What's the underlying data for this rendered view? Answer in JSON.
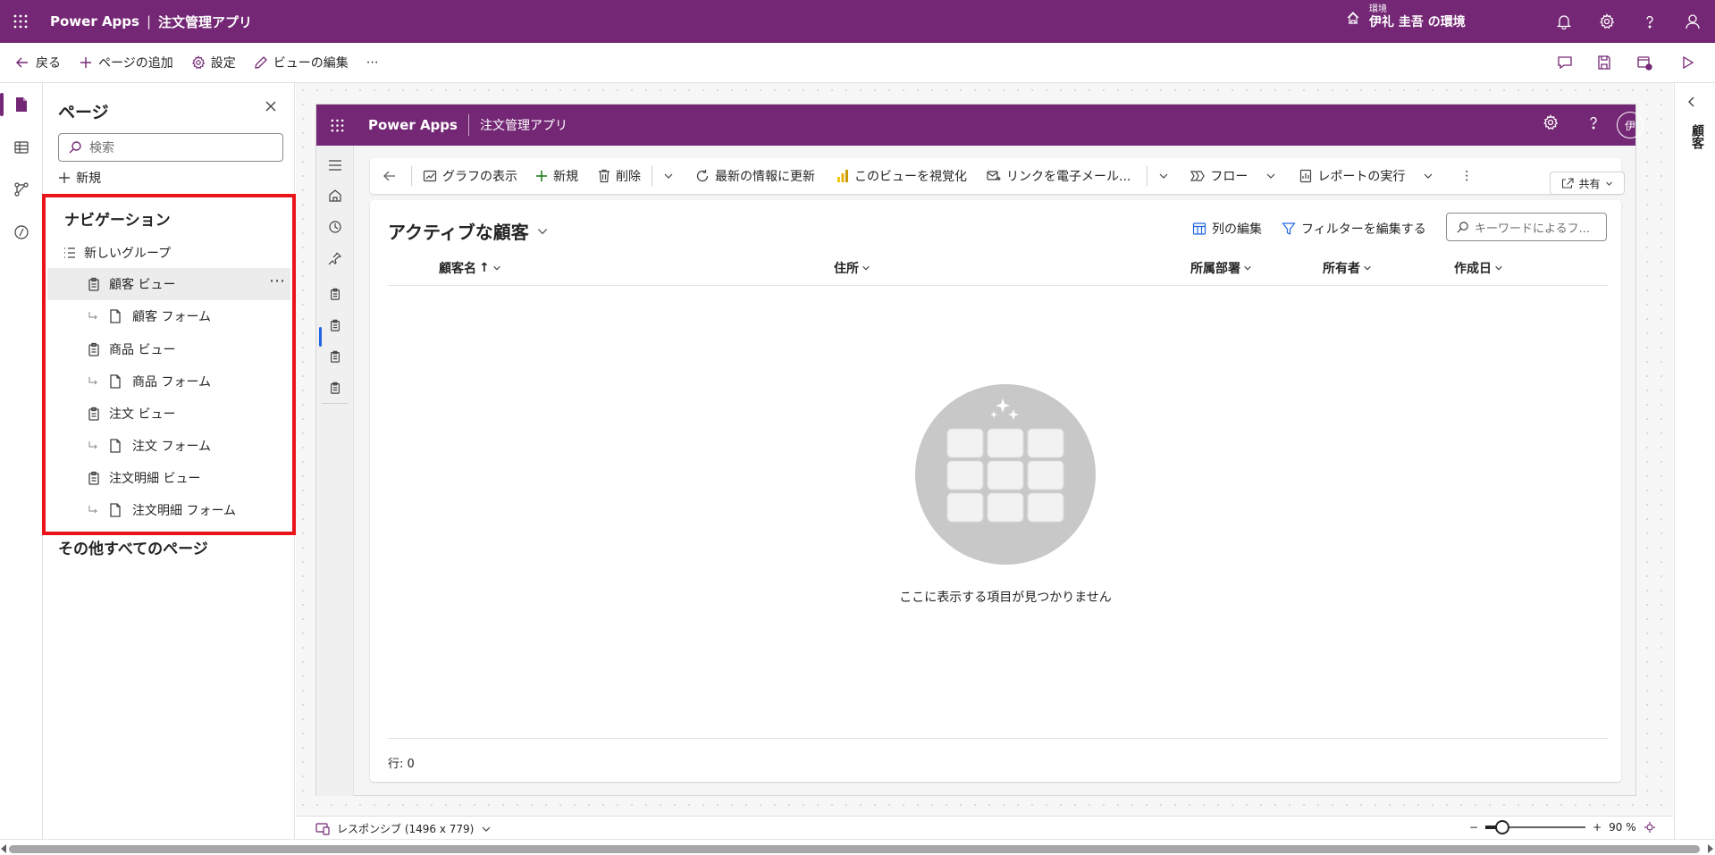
{
  "header": {
    "product": "Power Apps",
    "separator": "|",
    "app_name": "注文管理アプリ",
    "env_label": "環境",
    "env_name": "伊礼 圭吾 の環境"
  },
  "commandbar": {
    "back": "戻る",
    "add_page": "ページの追加",
    "settings": "設定",
    "edit_view": "ビューの編集",
    "more": "⋯"
  },
  "pages_panel": {
    "title": "ページ",
    "search_placeholder": "検索",
    "new_label": "新規",
    "navigation_title": "ナビゲーション",
    "group_label": "新しいグループ",
    "items": [
      {
        "label": "顧客 ビュー",
        "type": "view"
      },
      {
        "label": "顧客 フォーム",
        "type": "form"
      },
      {
        "label": "商品 ビュー",
        "type": "view"
      },
      {
        "label": "商品 フォーム",
        "type": "form"
      },
      {
        "label": "注文 ビュー",
        "type": "view"
      },
      {
        "label": "注文 フォーム",
        "type": "form"
      },
      {
        "label": "注文明細 ビュー",
        "type": "view"
      },
      {
        "label": "注文明細 フォーム",
        "type": "form"
      }
    ],
    "item_more": "⋯",
    "others_title": "その他すべてのページ"
  },
  "right_panel": {
    "title": "顧客"
  },
  "app_preview": {
    "product": "Power Apps",
    "app_name": "注文管理アプリ",
    "avatar_initial": "伊",
    "toolbar": {
      "show_chart": "グラフの表示",
      "new": "新規",
      "delete": "削除",
      "refresh": "最新の情報に更新",
      "visualize": "このビューを視覚化",
      "email_link": "リンクを電子メール...",
      "flow": "フロー",
      "run_report": "レポートの実行",
      "more": "⋮",
      "share": "共有"
    },
    "grid": {
      "view_title": "アクティブな顧客",
      "edit_columns": "列の編集",
      "edit_filters": "フィルターを編集する",
      "search_placeholder": "キーワードによるフ...",
      "columns": [
        {
          "label": "顧客名",
          "sort": "↑"
        },
        {
          "label": "住所"
        },
        {
          "label": "所属部署"
        },
        {
          "label": "所有者"
        },
        {
          "label": "作成日"
        }
      ],
      "empty_message": "ここに表示する項目が見つかりません",
      "row_count": "行: 0"
    }
  },
  "status_bar": {
    "layout": "レスポンシブ (1496 x 779)",
    "zoom_minus": "−",
    "zoom_plus": "+",
    "zoom_level": "90 %",
    "zoom_fraction": 0.1
  },
  "colors": {
    "brand_purple": "#742774",
    "highlight_red": "#e8141a",
    "selection_gray": "#ececec"
  }
}
